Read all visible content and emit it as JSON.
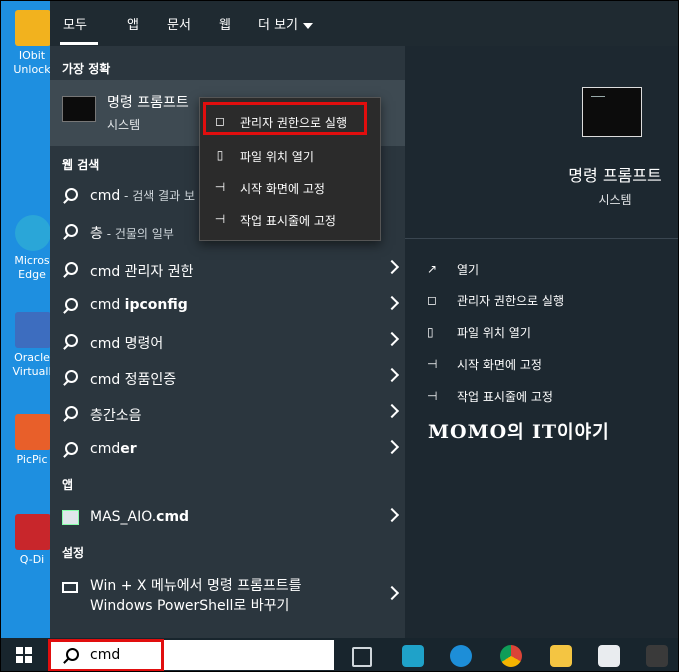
{
  "desktop": {
    "icons": [
      {
        "label": "IObit Unlocker",
        "color": "#f2b21e"
      },
      {
        "label": "Microsoft Edge",
        "color": "#2aa6d8"
      },
      {
        "label": "Oracle VirtualBox",
        "color": "#3d6dbf"
      },
      {
        "label": "PicPick",
        "color": "#e85f2a"
      },
      {
        "label": "Q-Dir",
        "color": "#c8262b"
      }
    ],
    "icon_labels": [
      "IObit\nUnlock",
      "Micros\nEdge",
      "Oracle\nVirtuall",
      "PicPic",
      "Q-Di"
    ]
  },
  "tabs": {
    "all": "모두",
    "apps": "앱",
    "documents": "문서",
    "web": "웹",
    "more": "더 보기"
  },
  "results": {
    "best_match_heading": "가장 정확",
    "best_match": {
      "name": "명령 프롬프트",
      "type": "시스템"
    },
    "web_heading": "웹 검색",
    "web_items": [
      {
        "main": "cmd",
        "sub": " - 검색 결과 보"
      },
      {
        "main": "층",
        "sub": " - 건물의 일부"
      },
      {
        "main": "cmd 관리자 권한",
        "sub": ""
      },
      {
        "main_prefix": "cmd ",
        "main_bold": "ipconfig"
      },
      {
        "main": "cmd 명령어",
        "sub": ""
      },
      {
        "main": "cmd 정품인증",
        "sub": ""
      },
      {
        "main": "층간소음",
        "sub": ""
      },
      {
        "main_prefix": "cmd",
        "main_bold": "er"
      }
    ],
    "apps_heading": "앱",
    "app_item": {
      "main_prefix": "MAS_AIO.",
      "main_bold": "cmd"
    },
    "settings_heading": "설정",
    "settings_item": {
      "line1": "Win + X 메뉴에서 명령 프롬프트를",
      "line2": "Windows PowerShell로 바꾸기"
    }
  },
  "context_menu": {
    "items": [
      "관리자 권한으로 실행",
      "파일 위치 열기",
      "시작 화면에 고정",
      "작업 표시줄에 고정"
    ]
  },
  "detail": {
    "title": "명령 프롬프트",
    "subtitle": "시스템",
    "actions": [
      "열기",
      "관리자 권한으로 실행",
      "파일 위치 열기",
      "시작 화면에 고정",
      "작업 표시줄에 고정"
    ]
  },
  "watermark": {
    "part1": "MOMO",
    "part2": "의 ",
    "part3": "IT",
    "part4": "이야기"
  },
  "taskbar": {
    "search_value": "cmd",
    "apps": [
      "task-view-icon",
      "photoshop-like-icon",
      "edge-icon",
      "chrome-icon",
      "file-explorer-icon",
      "store-icon",
      "picpick-icon"
    ]
  },
  "colors": {
    "highlight": "#e10e0e",
    "panel": "#28323a",
    "detail": "#1d2830",
    "desktop": "#1e8fe0"
  }
}
